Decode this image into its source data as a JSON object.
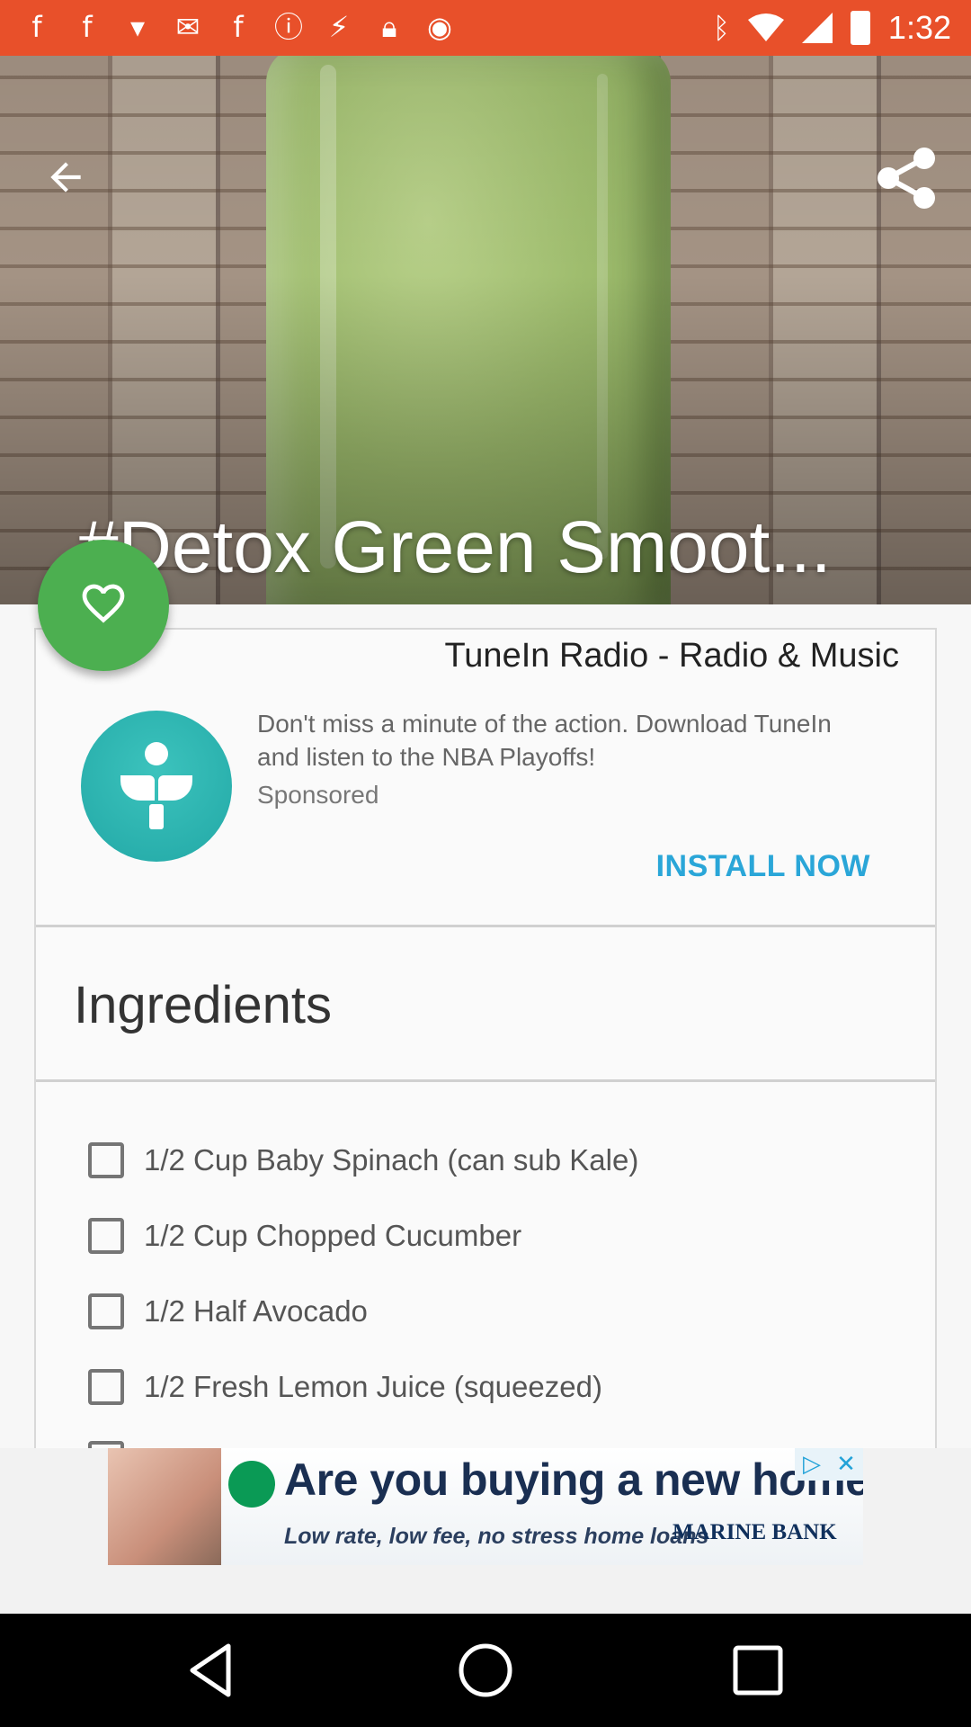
{
  "status_bar": {
    "notification_icons": [
      "facebook-icon",
      "facebook-icon",
      "tie-icon",
      "gmail-icon",
      "facebook-icon",
      "alert-circle-icon",
      "satellite-icon",
      "lock-icon",
      "android-icon"
    ],
    "right_icons": [
      "bluetooth-icon",
      "wifi-icon",
      "signal-icon",
      "battery-icon"
    ],
    "time": "1:32",
    "background_color": "#e8502a"
  },
  "hero": {
    "title": "#Detox Green Smoot...",
    "back_icon": "arrow-back-icon",
    "share_icon": "share-icon"
  },
  "favorite": {
    "icon": "heart-outline-icon",
    "color": "#4caf50"
  },
  "ad_card": {
    "title": "TuneIn Radio - Radio & Music",
    "description": "Don't miss a minute of the action. Download TuneIn and listen to the NBA Playoffs!",
    "sponsored_label": "Sponsored",
    "install_label": "INSTALL NOW",
    "accent_color": "#2aa6d8"
  },
  "ingredients": {
    "heading": "Ingredients",
    "items": [
      {
        "label": "1/2 Cup Baby Spinach (can sub Kale)",
        "checked": false
      },
      {
        "label": "1/2 Cup Chopped Cucumber",
        "checked": false
      },
      {
        "label": "1/2 Half Avocado",
        "checked": false
      },
      {
        "label": "1/2 Fresh Lemon Juice (squeezed)",
        "checked": false
      }
    ]
  },
  "banner_ad": {
    "headline": "Are you buying a new home?",
    "subline": "Low rate, low fee, no stress home loans",
    "brand": "MARINE BANK",
    "adchoices_icon": "adchoices-icon",
    "close_icon": "close-icon"
  },
  "nav_bar": {
    "buttons": [
      "back-triangle-icon",
      "home-circle-icon",
      "recents-square-icon"
    ]
  }
}
